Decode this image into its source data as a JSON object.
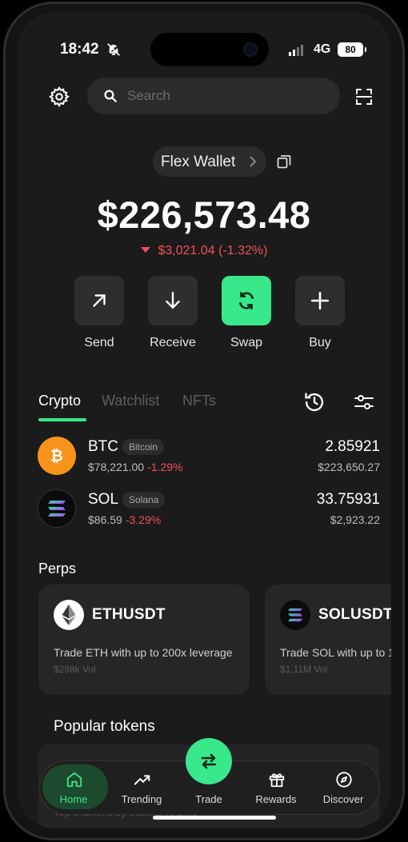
{
  "status_bar": {
    "time": "18:42",
    "network": "4G",
    "battery": "80"
  },
  "search": {
    "placeholder": "Search"
  },
  "wallet": {
    "name": "Flex Wallet"
  },
  "portfolio": {
    "balance": "$226,573.48",
    "change": "$3,021.04 (-1.32%)",
    "change_color": "#f0505a"
  },
  "actions": [
    {
      "label": "Send",
      "icon": "arrow-up-right-icon"
    },
    {
      "label": "Receive",
      "icon": "arrow-down-icon"
    },
    {
      "label": "Swap",
      "icon": "swap-icon",
      "highlighted": true
    },
    {
      "label": "Buy",
      "icon": "plus-icon"
    }
  ],
  "tabs": [
    {
      "label": "Crypto",
      "active": true
    },
    {
      "label": "Watchlist",
      "active": false
    },
    {
      "label": "NFTs",
      "active": false
    }
  ],
  "assets": [
    {
      "symbol": "BTC",
      "name": "Bitcoin",
      "price": "$78,221.00",
      "change": "-1.29%",
      "amount": "2.85921",
      "value": "$223,650.27"
    },
    {
      "symbol": "SOL",
      "name": "Solana",
      "price": "$86.59",
      "change": "-3.29%",
      "amount": "33.75931",
      "value": "$2,923.22"
    }
  ],
  "perps": {
    "title": "Perps",
    "items": [
      {
        "name": "ETHUSDT",
        "description": "Trade ETH with up to 200x leverage",
        "volume": "$298k Vol"
      },
      {
        "name": "SOLUSDT",
        "description": "Trade SOL with up to 1(",
        "volume": "$1.11M Vol"
      }
    ]
  },
  "popular": {
    "title": "Popular tokens",
    "subtitle": "Top 5 tokens by trading volume"
  },
  "nav": [
    {
      "label": "Home",
      "icon": "home-icon",
      "active": true
    },
    {
      "label": "Trending",
      "icon": "trending-icon",
      "active": false
    },
    {
      "label": "Trade",
      "icon": "swap-arrows-icon",
      "active": false
    },
    {
      "label": "Rewards",
      "icon": "gift-icon",
      "active": false
    },
    {
      "label": "Discover",
      "icon": "compass-icon",
      "active": false
    }
  ],
  "colors": {
    "accent": "#39e88a",
    "negative": "#f0505a",
    "background": "#1b1b1b",
    "card": "#262626"
  }
}
